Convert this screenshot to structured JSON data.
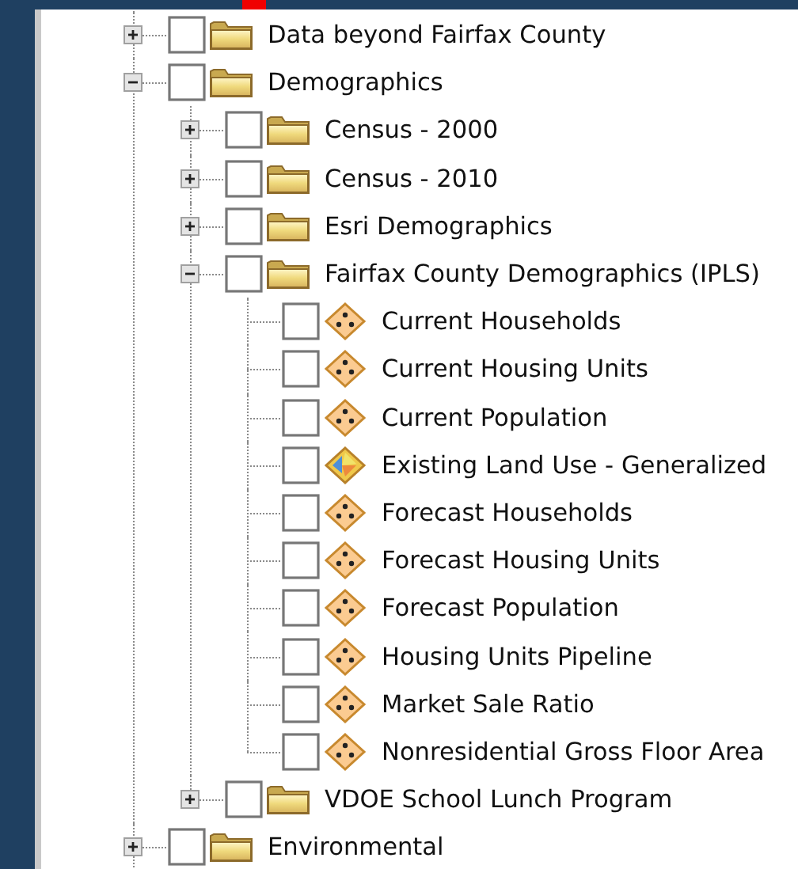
{
  "tree": [
    {
      "label": "Data beyond Fairfax County",
      "kind": "folder",
      "checked": false,
      "expanded": false
    },
    {
      "label": "Demographics",
      "kind": "folder",
      "checked": false,
      "expanded": true,
      "children": [
        {
          "label": "Census - 2000",
          "kind": "folder",
          "checked": false,
          "expanded": false
        },
        {
          "label": "Census - 2010",
          "kind": "folder",
          "checked": false,
          "expanded": false
        },
        {
          "label": "Esri Demographics",
          "kind": "folder",
          "checked": false,
          "expanded": false
        },
        {
          "label": "Fairfax County Demographics (IPLS)",
          "kind": "folder",
          "checked": false,
          "expanded": true,
          "children": [
            {
              "label": "Current Households",
              "kind": "point-layer",
              "checked": false
            },
            {
              "label": "Current Housing Units",
              "kind": "point-layer",
              "checked": false
            },
            {
              "label": "Current Population",
              "kind": "point-layer",
              "checked": false
            },
            {
              "label": "Existing Land Use - Generalized",
              "kind": "polygon-layer",
              "checked": false
            },
            {
              "label": "Forecast Households",
              "kind": "point-layer",
              "checked": false
            },
            {
              "label": "Forecast Housing Units",
              "kind": "point-layer",
              "checked": false
            },
            {
              "label": "Forecast Population",
              "kind": "point-layer",
              "checked": false
            },
            {
              "label": "Housing Units Pipeline",
              "kind": "point-layer",
              "checked": false
            },
            {
              "label": "Market Sale Ratio",
              "kind": "point-layer",
              "checked": false
            },
            {
              "label": "Nonresidential Gross Floor Area",
              "kind": "point-layer",
              "checked": false
            }
          ]
        },
        {
          "label": "VDOE School Lunch Program",
          "kind": "folder",
          "checked": false,
          "expanded": false
        }
      ]
    },
    {
      "label": "Environmental",
      "kind": "folder",
      "checked": false,
      "expanded": false
    }
  ]
}
